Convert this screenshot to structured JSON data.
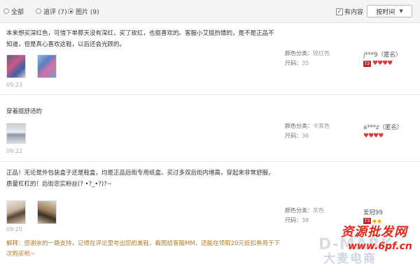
{
  "filters": {
    "all_label": "全部",
    "followup_label": "追评 (7)",
    "pictures_label": "图片 (9)",
    "selected": "pictures",
    "has_content_label": "有内容",
    "has_content_checked": true,
    "sort_label": "按时间"
  },
  "reviews": [
    {
      "text": "本来想买深红色，可惜下单那天没有深红，买了玫红，也挺喜欢的。客服小艾挺热情的，是不是正品不知道，但是真心喜欢这鞋，以后还会光顾的。",
      "time": "09:23",
      "color_label": "颜色分类：",
      "color_value": "玫红色",
      "size_label": "尺码：",
      "size_value": "35",
      "user": "j***9（匿名）",
      "level": "T2",
      "badge": "hearts",
      "badge_count": 4,
      "thumb_count": 2
    },
    {
      "text": "穿着挺舒适的",
      "time": "09:22",
      "color_label": "颜色分类：",
      "color_value": "卡其色",
      "size_label": "尺码：",
      "size_value": "36",
      "user": "a***z（匿名）",
      "level": "",
      "badge": "hearts",
      "badge_count": 4,
      "thumb_count": 1
    },
    {
      "text": "正品！无论是外包装盒子还是鞋盒，均是正品后街专用纸盒。买过多双后街内增高，穿起来非常舒服，质量杠杠的！后街忠实粉丝(? •?_•?)?~",
      "time": "09:20",
      "color_label": "颜色分类：",
      "color_value": "灰色",
      "size_label": "尺码：",
      "size_value": "38",
      "user": "爱冠99",
      "level": "T3",
      "badge": "diamonds",
      "badge_count": 2,
      "thumb_count": 2
    }
  ],
  "reply": "解释：感谢亲的一路支持，记得在评论里夸出您的美鞋，截图给客服MM，还能在领取20元抵扣券用于下次购买哟~",
  "watermarks": {
    "site_cn": "资源批发网",
    "site_url": "www.6pf.cn",
    "brand_en": "D-MARK",
    "brand_cn": "大麦电商"
  },
  "colors": {
    "filterbar_bg": "#f5f5f5",
    "reply_text": "#b07b2a",
    "level_badge": "#c0282c",
    "heart": "#d63a3a",
    "diamond": "#f0b400",
    "watermark_red": "#e8261a"
  }
}
